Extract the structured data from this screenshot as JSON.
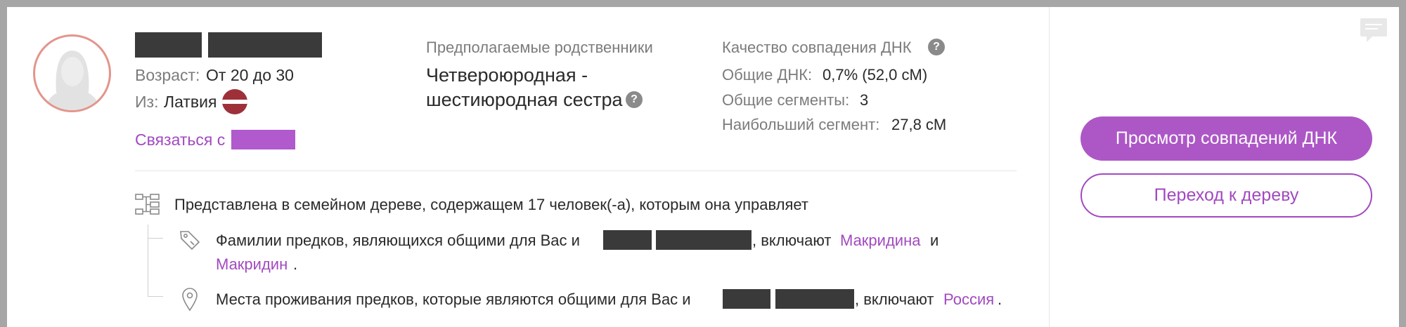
{
  "profile": {
    "age_label": "Возраст:",
    "age_value": "От 20 до 30",
    "from_label": "Из:",
    "from_value": "Латвия",
    "contact_label": "Связаться с"
  },
  "relationship": {
    "heading": "Предполагаемые родственники",
    "line1": "Четвероюродная -",
    "line2": "шестиюродная сестра",
    "help_glyph": "?"
  },
  "dna": {
    "heading": "Качество совпадения ДНК",
    "help_glyph": "?",
    "shared_label": "Общие ДНК:",
    "shared_value": "0,7% (52,0 сМ)",
    "segments_label": "Общие сегменты:",
    "segments_value": "3",
    "largest_label": "Наибольший сегмент:",
    "largest_value": "27,8 сМ"
  },
  "tree_info": {
    "text": "Представлена в семейном дереве, содержащем 17 человек(-а), которым она управляет",
    "surnames_prefix": "Фамилии предков, являющихся общими для Вас и",
    "surnames_mid": ", включают",
    "surname1": "Макридина",
    "surnames_and": "и",
    "surname2": "Макридин",
    "surnames_end": ".",
    "places_prefix": "Места проживания предков, которые являются общими для Вас и",
    "places_mid": ", включают",
    "place1": "Россия",
    "places_end": "."
  },
  "actions": {
    "view_matches": "Просмотр совпадений ДНК",
    "go_to_tree": "Переход к дереву"
  },
  "colors": {
    "accent": "#ad57c7",
    "link": "#a249c0",
    "avatar_border": "#e3948c",
    "flag_red": "#9e3039"
  },
  "icons": [
    "avatar-placeholder-icon",
    "help-icon",
    "latvia-flag-icon",
    "family-tree-icon",
    "tag-icon",
    "location-pin-icon",
    "chat-icon"
  ]
}
